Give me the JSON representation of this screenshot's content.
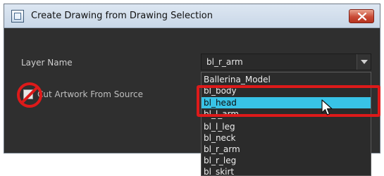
{
  "window": {
    "title": "Create Drawing from Drawing Selection",
    "icon": "dialog-window-icon",
    "close_icon": "close-icon"
  },
  "form": {
    "layer_name_label": "Layer Name",
    "layer_name_value": "bl_r_arm",
    "cut_artwork_label": "Cut Artwork From Source",
    "cut_artwork_checked": false
  },
  "dropdown": {
    "items": [
      "Ballerina_Model",
      "bl_body",
      "bl_head",
      "bl_l_arm",
      "bl_l_leg",
      "bl_neck",
      "bl_r_arm",
      "bl_r_leg",
      "bl_skirt"
    ],
    "selected_index": 2
  },
  "annotations": {
    "highlight_color": "#dd1a1a",
    "prohibition_symbol": "no-symbol-icon",
    "pointer": "mouse-cursor-icon"
  },
  "colors": {
    "selection": "#38c3e7",
    "dialog_background": "#2f2f2f"
  }
}
